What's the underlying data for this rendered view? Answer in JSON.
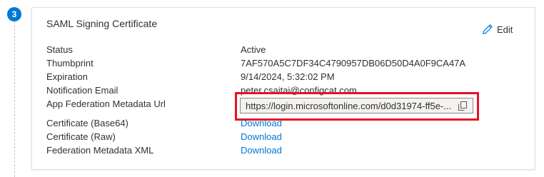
{
  "step": {
    "number": "3"
  },
  "card": {
    "title": "SAML Signing Certificate",
    "edit_label": "Edit"
  },
  "fields": [
    {
      "label": "Status",
      "value": "Active"
    },
    {
      "label": "Thumbprint",
      "value": "7AF570A5C7DF34C4790957DB06D50D4A0F9CA47A"
    },
    {
      "label": "Expiration",
      "value": "9/14/2024, 5:32:02 PM"
    },
    {
      "label": "Notification Email",
      "value": "peter.csaitai@configcat.com"
    },
    {
      "label": "App Federation Metadata Url",
      "value": "https://login.microsoftonline.com/d0d31974-ff5e-..."
    },
    {
      "label": "Certificate (Base64)",
      "value": "Download"
    },
    {
      "label": "Certificate (Raw)",
      "value": "Download"
    },
    {
      "label": "Federation Metadata XML",
      "value": "Download"
    }
  ],
  "colors": {
    "accent": "#0078d4",
    "highlight": "#e81123"
  },
  "icons": {
    "edit": "pencil-icon",
    "copy": "copy-icon"
  }
}
